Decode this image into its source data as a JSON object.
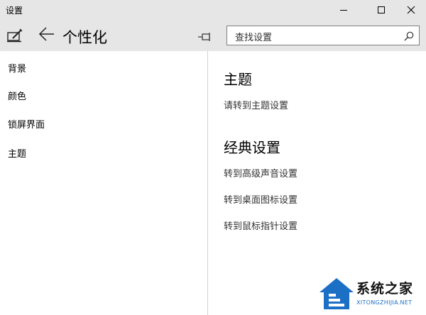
{
  "window": {
    "title": "设置"
  },
  "header": {
    "page_title": "个性化",
    "search_placeholder": "查找设置"
  },
  "sidebar": {
    "items": [
      {
        "label": "背景"
      },
      {
        "label": "颜色"
      },
      {
        "label": "锁屏界面"
      },
      {
        "label": "主题"
      }
    ]
  },
  "content": {
    "theme_section": {
      "heading": "主题",
      "links": [
        "请转到主题设置"
      ]
    },
    "classic_section": {
      "heading": "经典设置",
      "links": [
        "转到高级声音设置",
        "转到桌面图标设置",
        "转到鼠标指针设置"
      ]
    }
  },
  "watermark": {
    "brand": "系统之家",
    "url": "XITONGZHIJIA.NET"
  },
  "colors": {
    "titlebar_bg": "#e6e6e6",
    "content_bg": "#ffffff",
    "divider": "#d2d2d2",
    "watermark_blue": "#1b6fc4"
  },
  "icons": {
    "brush": "personalization-brush-icon",
    "back": "back-arrow-icon",
    "pin": "pin-icon",
    "search": "search-icon",
    "minimize": "minimize-icon",
    "maximize": "maximize-icon",
    "close": "close-icon"
  }
}
